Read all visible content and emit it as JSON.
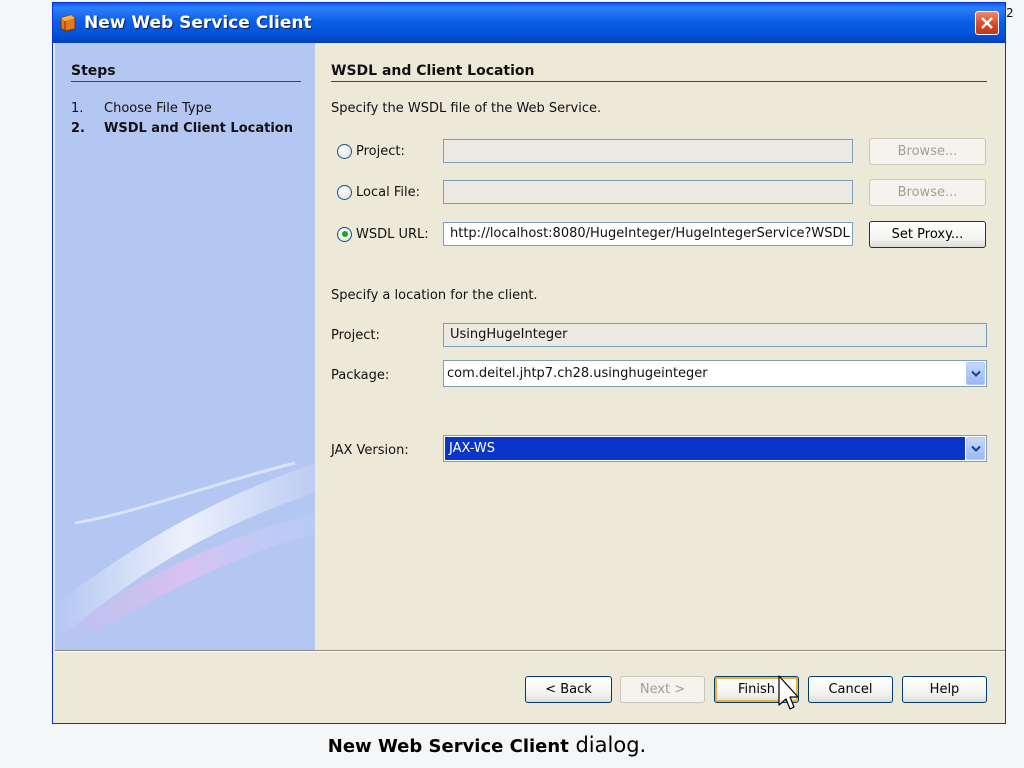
{
  "page_number": "2",
  "window": {
    "title": "New Web Service Client"
  },
  "steps": {
    "heading": "Steps",
    "items": [
      {
        "num": "1.",
        "label": "Choose File Type",
        "current": false
      },
      {
        "num": "2.",
        "label": "WSDL and Client Location",
        "current": true
      }
    ]
  },
  "content": {
    "section_title": "WSDL and Client Location",
    "wsdl_instruction": "Specify the WSDL file of the Web Service.",
    "sources": {
      "project_label": "Project:",
      "local_file_label": "Local File:",
      "wsdl_url_label": "WSDL URL:",
      "project_value": "",
      "local_file_value": "",
      "wsdl_url_value": "http://localhost:8080/HugeInteger/HugeIntegerService?WSDL",
      "selected": "WSDL URL",
      "browse_label": "Browse...",
      "set_proxy_label": "Set Proxy..."
    },
    "client_instruction": "Specify a location for the client.",
    "client_project_label": "Project:",
    "client_project_value": "UsingHugeInteger",
    "package_label": "Package:",
    "package_value": "com.deitel.jhtp7.ch28.usinghugeinteger",
    "jax_label": "JAX Version:",
    "jax_value": "JAX-WS"
  },
  "buttons": {
    "back": "< Back",
    "next": "Next >",
    "finish": "Finish",
    "cancel": "Cancel",
    "help": "Help"
  },
  "caption": {
    "bold": "New Web Service Client",
    "rest": " dialog."
  },
  "colors": {
    "titlebar": "#0a5cf0",
    "steps_panel": "#b4c6f2",
    "dialog_bg": "#ece9d8",
    "selection": "#0b35c9"
  }
}
